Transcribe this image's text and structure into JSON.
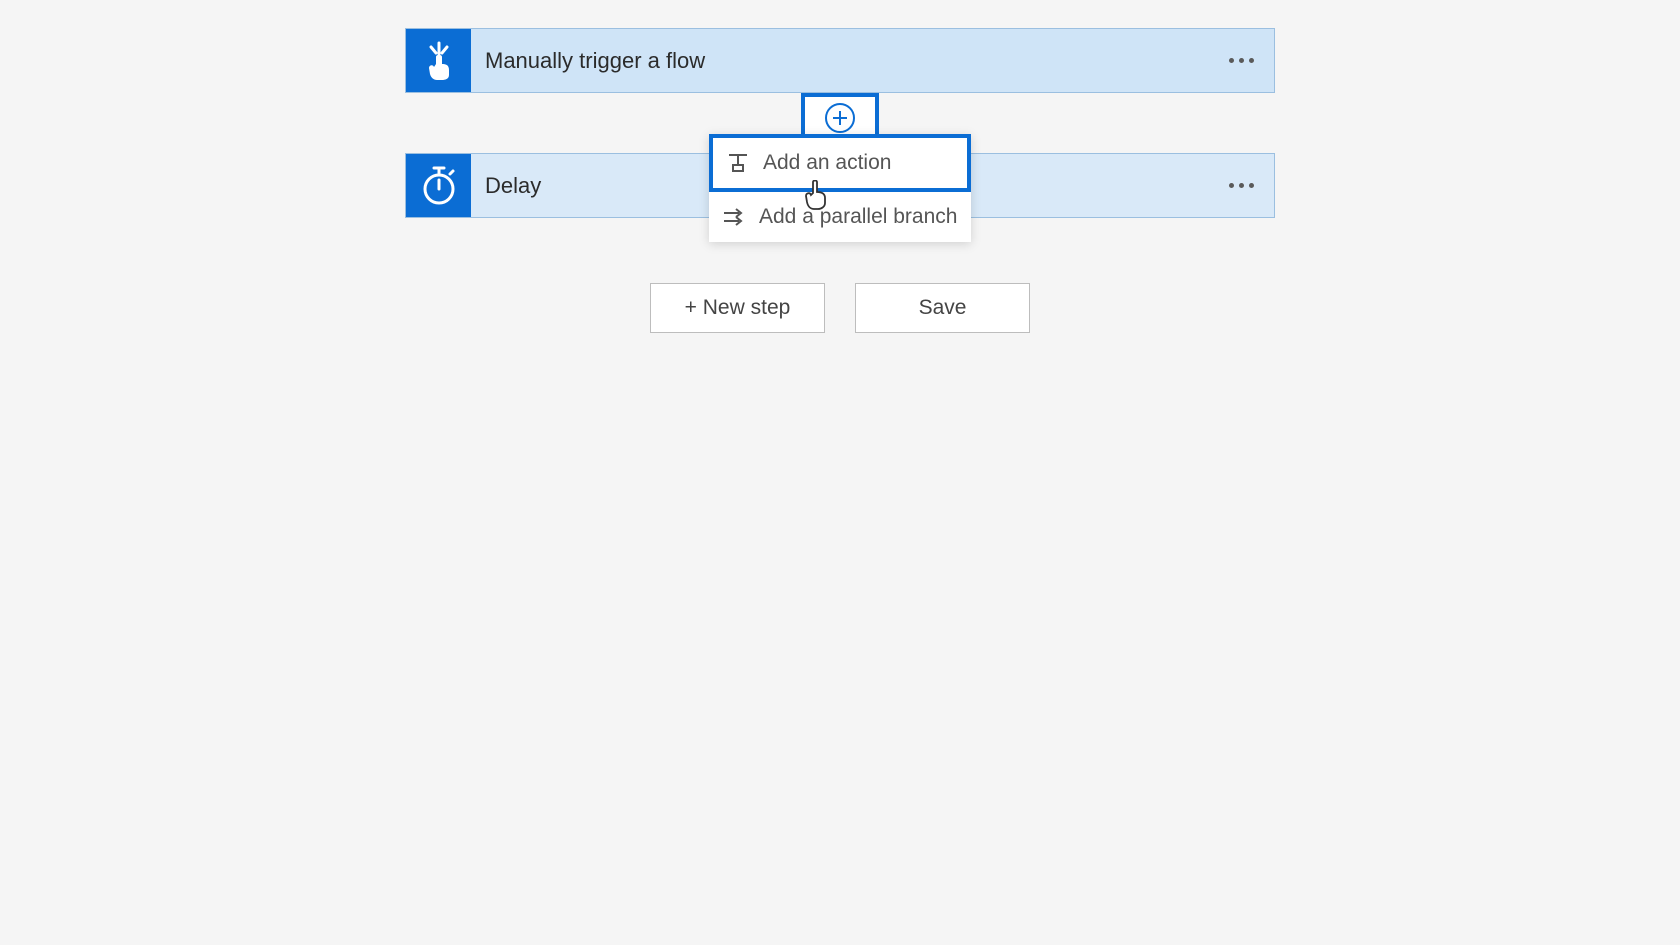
{
  "cards": [
    {
      "title": "Manually trigger a flow"
    },
    {
      "title": "Delay"
    }
  ],
  "dropdown": {
    "add_action_label": "Add an action",
    "add_parallel_label": "Add a parallel branch"
  },
  "buttons": {
    "new_step": "+ New step",
    "save": "Save"
  }
}
